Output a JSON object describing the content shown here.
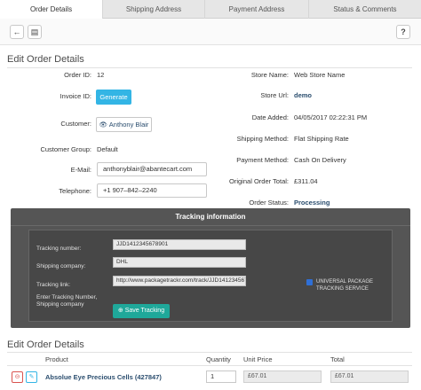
{
  "tabs": [
    "Order Details",
    "Shipping Address",
    "Payment Address",
    "Status & Comments"
  ],
  "toolbar": {
    "back_icon": "arrow-left-icon",
    "doc_icon": "document-icon",
    "help_icon": "question-icon"
  },
  "section1": {
    "title": "Edit Order Details"
  },
  "left": {
    "order_id_label": "Order ID:",
    "order_id": "12",
    "invoice_label": "Invoice ID:",
    "generate_button": "Generate",
    "customer_label": "Customer:",
    "customer_name": "Anthony Blair",
    "group_label": "Customer Group:",
    "group_value": "Default",
    "email_label": "E-Mail:",
    "email_value": "anthonyblair@abantecart.com",
    "phone_label": "Telephone:",
    "phone_value": "+1 907–842–2240"
  },
  "right": {
    "store_name_label": "Store Name:",
    "store_name": "Web Store Name",
    "store_url_label": "Store Url:",
    "store_url": "demo",
    "date_label": "Date Added:",
    "date_value": "04/05/2017 02:22:31 PM",
    "ship_method_label": "Shipping Method:",
    "ship_method": "Flat Shipping Rate",
    "pay_method_label": "Payment Method:",
    "pay_method": "Cash On Delivery",
    "orig_total_label": "Original Order Total:",
    "orig_total": "£311.04",
    "status_label": "Order Status:",
    "status_value": "Processing"
  },
  "tracking": {
    "header": "Tracking information",
    "number_label": "Tracking number:",
    "number_value": "JJD1412345678901",
    "company_label": "Shipping company:",
    "company_value": "DHL",
    "link_label": "Tracking link:",
    "link_value": "http://www.packagetrackr.com/track/JJD141234567",
    "enter_label": "Enter Tracking Number, Shipping company",
    "checkbox_label": "UNIVERSAL PACKAGE TRACKING SERVICE",
    "checkbox_checked": true,
    "save_button": "Save Tracking"
  },
  "section2": {
    "title": "Edit Order Details",
    "columns": [
      "Product",
      "Quantity",
      "Unit Price",
      "Total"
    ],
    "rows": [
      {
        "product": "Absolue Eye Precious Cells (427847)",
        "quantity": "1",
        "unit_price": "£67.01",
        "total": "£67.01"
      }
    ]
  },
  "colors": {
    "accent": "#33b5e5",
    "save": "#1fa89a",
    "tracking_bg": "#555555",
    "link": "#2a4d6e"
  }
}
